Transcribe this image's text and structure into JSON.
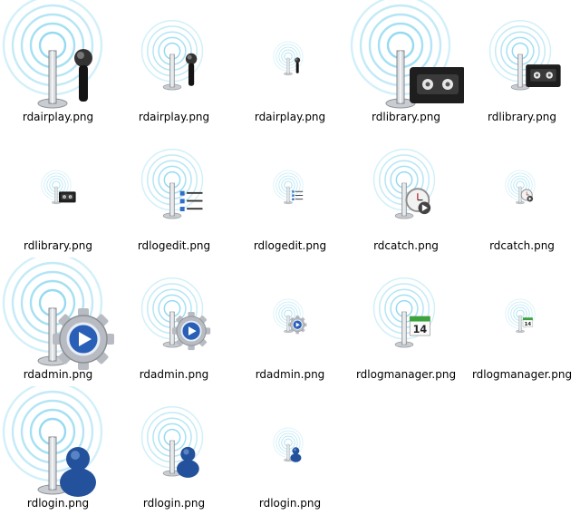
{
  "files": [
    {
      "name": "rdairplay.png",
      "icon": "airplay-microphone-icon",
      "size": "large"
    },
    {
      "name": "rdairplay.png",
      "icon": "airplay-microphone-icon",
      "size": "medium"
    },
    {
      "name": "rdairplay.png",
      "icon": "airplay-microphone-icon",
      "size": "small"
    },
    {
      "name": "rdlibrary.png",
      "icon": "library-cassette-icon",
      "size": "large"
    },
    {
      "name": "rdlibrary.png",
      "icon": "library-cassette-icon",
      "size": "medium"
    },
    {
      "name": "rdlibrary.png",
      "icon": "library-cassette-icon",
      "size": "small"
    },
    {
      "name": "rdlogedit.png",
      "icon": "logedit-list-icon",
      "size": "medium"
    },
    {
      "name": "rdlogedit.png",
      "icon": "logedit-list-icon",
      "size": "small"
    },
    {
      "name": "rdcatch.png",
      "icon": "catch-clock-icon",
      "size": "medium"
    },
    {
      "name": "rdcatch.png",
      "icon": "catch-clock-icon",
      "size": "small"
    },
    {
      "name": "rdadmin.png",
      "icon": "admin-gear-icon",
      "size": "large"
    },
    {
      "name": "rdadmin.png",
      "icon": "admin-gear-icon",
      "size": "medium"
    },
    {
      "name": "rdadmin.png",
      "icon": "admin-gear-icon",
      "size": "small"
    },
    {
      "name": "rdlogmanager.png",
      "icon": "logmanager-calendar-icon",
      "size": "medium",
      "badge": "14"
    },
    {
      "name": "rdlogmanager.png",
      "icon": "logmanager-calendar-icon",
      "size": "small",
      "badge": "14"
    },
    {
      "name": "rdlogin.png",
      "icon": "login-user-icon",
      "size": "large"
    },
    {
      "name": "rdlogin.png",
      "icon": "login-user-icon",
      "size": "medium"
    },
    {
      "name": "rdlogin.png",
      "icon": "login-user-icon",
      "size": "small"
    }
  ],
  "colors": {
    "rings": "#7fd3ee",
    "tower": "#9aa0a6",
    "badge_green": "#3aa53a",
    "gear": "#b8bcc2",
    "play_blue": "#2a5fb8",
    "user_blue": "#23519b",
    "cassette": "#1e1e1e"
  }
}
